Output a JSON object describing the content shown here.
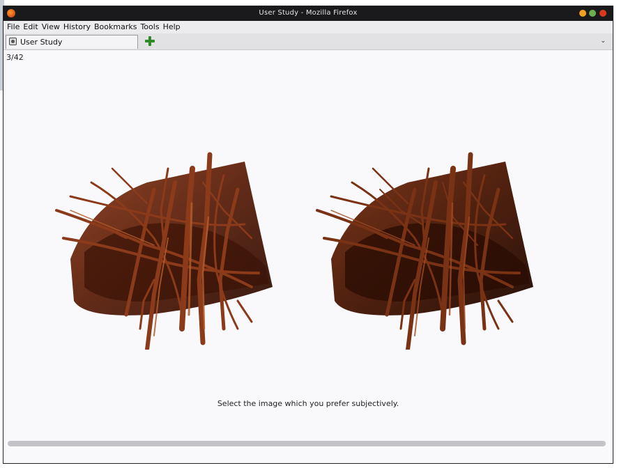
{
  "window": {
    "title": "User Study - Mozilla Firefox"
  },
  "menu": {
    "items": [
      "File",
      "Edit",
      "View",
      "History",
      "Bookmarks",
      "Tools",
      "Help"
    ]
  },
  "tabs": [
    {
      "label": "User Study"
    }
  ],
  "tablist_glyph": "⌄",
  "page": {
    "counter": "3/42",
    "instruction": "Select the image which you prefer subjectively."
  },
  "icons": {
    "app": "firefox-icon",
    "favicon": "page-favicon-icon",
    "new_tab": "plus-icon",
    "tab_list": "chevron-down-icon"
  },
  "colors": {
    "rendering_base": "#6b2a12",
    "rendering_highlight": "#b35a2b",
    "rendering_shadow": "#2e0e05"
  }
}
